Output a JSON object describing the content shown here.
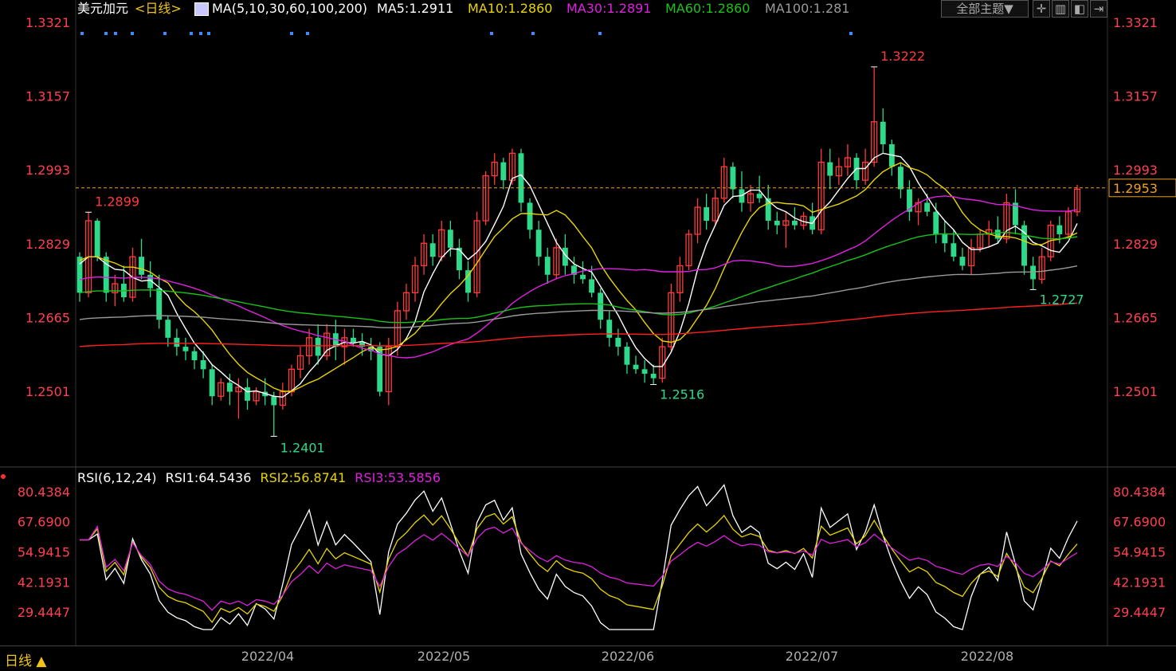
{
  "header": {
    "pair": "美元加元",
    "period": "<日线>",
    "ma_label": "MA(5,10,30,60,100,200)",
    "ma5": "MA5:1.2911",
    "ma10": "MA10:1.2860",
    "ma30": "MA30:1.2891",
    "ma60": "MA60:1.2860",
    "ma100": "MA100:1.281",
    "theme_button": "全部主题▼"
  },
  "rsi_header": {
    "label": "RSI(6,12,24)",
    "rsi1": "RSI1:64.5436",
    "rsi2": "RSI2:56.8741",
    "rsi3": "RSI3:53.5856"
  },
  "footer": {
    "period": "日线 ▲"
  },
  "colors": {
    "up": "#ff3b3b",
    "down": "#2fd98a",
    "ma5": "#ffffff",
    "ma10": "#e8d500",
    "ma30": "#e020e0",
    "ma60": "#19c219",
    "ma100": "#9a9a9a",
    "ma200": "#ff2020",
    "axis_text": "#ff4050",
    "rsi_text": "#ff4050",
    "month_text": "#b0b0b0"
  },
  "chart_data": [
    {
      "type": "candlestick",
      "title": "美元加元<日线>",
      "y_ticks": [
        1.3321,
        1.3157,
        1.2993,
        1.2829,
        1.2665,
        1.2501
      ],
      "ylim": [
        1.2501,
        1.3321
      ],
      "current_price": 1.2953,
      "annotations": [
        {
          "label": "1.2899",
          "value": 1.2899,
          "kind": "high"
        },
        {
          "label": "1.2401",
          "value": 1.2401,
          "kind": "low"
        },
        {
          "label": "1.3222",
          "value": 1.3222,
          "kind": "high"
        },
        {
          "label": "1.2516",
          "value": 1.2516,
          "kind": "low"
        },
        {
          "label": "1.2727",
          "value": 1.2727,
          "kind": "low"
        }
      ],
      "x_ticks": [
        "2022/04",
        "2022/05",
        "2022/06",
        "2022/07",
        "2022/08"
      ],
      "candles_ohlc": [
        [
          1.28,
          1.281,
          1.27,
          1.272
        ],
        [
          1.272,
          1.2899,
          1.271,
          1.288
        ],
        [
          1.288,
          1.2885,
          1.279,
          1.28
        ],
        [
          1.28,
          1.281,
          1.27,
          1.272
        ],
        [
          1.272,
          1.276,
          1.269,
          1.274
        ],
        [
          1.274,
          1.278,
          1.27,
          1.271
        ],
        [
          1.271,
          1.282,
          1.27,
          1.28
        ],
        [
          1.28,
          1.284,
          1.275,
          1.276
        ],
        [
          1.276,
          1.279,
          1.271,
          1.273
        ],
        [
          1.273,
          1.276,
          1.264,
          1.266
        ],
        [
          1.266,
          1.267,
          1.26,
          1.262
        ],
        [
          1.262,
          1.264,
          1.258,
          1.26
        ],
        [
          1.26,
          1.262,
          1.257,
          1.259
        ],
        [
          1.259,
          1.26,
          1.255,
          1.257
        ],
        [
          1.257,
          1.259,
          1.253,
          1.255
        ],
        [
          1.255,
          1.256,
          1.247,
          1.249
        ],
        [
          1.249,
          1.253,
          1.248,
          1.252
        ],
        [
          1.252,
          1.254,
          1.247,
          1.25
        ],
        [
          1.25,
          1.253,
          1.244,
          1.251
        ],
        [
          1.251,
          1.253,
          1.246,
          1.248
        ],
        [
          1.248,
          1.251,
          1.247,
          1.25
        ],
        [
          1.25,
          1.253,
          1.247,
          1.249
        ],
        [
          1.249,
          1.25,
          1.2401,
          1.247
        ],
        [
          1.247,
          1.252,
          1.246,
          1.25
        ],
        [
          1.25,
          1.256,
          1.249,
          1.255
        ],
        [
          1.255,
          1.26,
          1.253,
          1.258
        ],
        [
          1.258,
          1.264,
          1.256,
          1.262
        ],
        [
          1.262,
          1.265,
          1.256,
          1.258
        ],
        [
          1.258,
          1.265,
          1.257,
          1.263
        ],
        [
          1.263,
          1.266,
          1.257,
          1.26
        ],
        [
          1.26,
          1.264,
          1.256,
          1.262
        ],
        [
          1.262,
          1.264,
          1.26,
          1.261
        ],
        [
          1.261,
          1.263,
          1.258,
          1.26
        ],
        [
          1.26,
          1.262,
          1.257,
          1.259
        ],
        [
          1.26,
          1.261,
          1.249,
          1.25
        ],
        [
          1.25,
          1.262,
          1.247,
          1.26
        ],
        [
          1.26,
          1.27,
          1.258,
          1.268
        ],
        [
          1.268,
          1.274,
          1.266,
          1.272
        ],
        [
          1.272,
          1.28,
          1.27,
          1.278
        ],
        [
          1.278,
          1.285,
          1.276,
          1.283
        ],
        [
          1.283,
          1.285,
          1.278,
          1.28
        ],
        [
          1.28,
          1.288,
          1.279,
          1.286
        ],
        [
          1.286,
          1.288,
          1.28,
          1.282
        ],
        [
          1.282,
          1.284,
          1.275,
          1.277
        ],
        [
          1.277,
          1.279,
          1.27,
          1.272
        ],
        [
          1.272,
          1.29,
          1.271,
          1.288
        ],
        [
          1.288,
          1.299,
          1.287,
          1.298
        ],
        [
          1.298,
          1.303,
          1.296,
          1.301
        ],
        [
          1.301,
          1.302,
          1.295,
          1.297
        ],
        [
          1.297,
          1.304,
          1.296,
          1.303
        ],
        [
          1.303,
          1.304,
          1.29,
          1.292
        ],
        [
          1.292,
          1.293,
          1.284,
          1.286
        ],
        [
          1.286,
          1.288,
          1.278,
          1.28
        ],
        [
          1.28,
          1.282,
          1.274,
          1.276
        ],
        [
          1.276,
          1.284,
          1.275,
          1.282
        ],
        [
          1.282,
          1.285,
          1.276,
          1.278
        ],
        [
          1.278,
          1.28,
          1.274,
          1.276
        ],
        [
          1.276,
          1.279,
          1.274,
          1.275
        ],
        [
          1.275,
          1.278,
          1.271,
          1.272
        ],
        [
          1.272,
          1.273,
          1.264,
          1.266
        ],
        [
          1.266,
          1.268,
          1.26,
          1.262
        ],
        [
          1.262,
          1.264,
          1.258,
          1.26
        ],
        [
          1.26,
          1.261,
          1.254,
          1.256
        ],
        [
          1.256,
          1.258,
          1.254,
          1.255
        ],
        [
          1.255,
          1.257,
          1.252,
          1.254
        ],
        [
          1.254,
          1.256,
          1.2516,
          1.253
        ],
        [
          1.253,
          1.262,
          1.252,
          1.26
        ],
        [
          1.26,
          1.274,
          1.259,
          1.272
        ],
        [
          1.272,
          1.28,
          1.27,
          1.278
        ],
        [
          1.278,
          1.286,
          1.277,
          1.285
        ],
        [
          1.285,
          1.293,
          1.283,
          1.291
        ],
        [
          1.291,
          1.294,
          1.286,
          1.288
        ],
        [
          1.288,
          1.295,
          1.287,
          1.293
        ],
        [
          1.293,
          1.302,
          1.292,
          1.3
        ],
        [
          1.3,
          1.301,
          1.293,
          1.295
        ],
        [
          1.295,
          1.299,
          1.29,
          1.292
        ],
        [
          1.292,
          1.296,
          1.29,
          1.294
        ],
        [
          1.294,
          1.298,
          1.292,
          1.293
        ],
        [
          1.293,
          1.296,
          1.286,
          1.288
        ],
        [
          1.288,
          1.29,
          1.285,
          1.287
        ],
        [
          1.287,
          1.29,
          1.282,
          1.288
        ],
        [
          1.288,
          1.291,
          1.286,
          1.287
        ],
        [
          1.287,
          1.29,
          1.286,
          1.289
        ],
        [
          1.289,
          1.292,
          1.285,
          1.286
        ],
        [
          1.286,
          1.304,
          1.285,
          1.301
        ],
        [
          1.301,
          1.304,
          1.295,
          1.298
        ],
        [
          1.298,
          1.302,
          1.296,
          1.3
        ],
        [
          1.3,
          1.305,
          1.298,
          1.302
        ],
        [
          1.302,
          1.303,
          1.295,
          1.297
        ],
        [
          1.297,
          1.304,
          1.296,
          1.301
        ],
        [
          1.301,
          1.3222,
          1.3,
          1.31
        ],
        [
          1.31,
          1.313,
          1.303,
          1.305
        ],
        [
          1.305,
          1.306,
          1.298,
          1.3
        ],
        [
          1.3,
          1.301,
          1.293,
          1.295
        ],
        [
          1.295,
          1.297,
          1.288,
          1.29
        ],
        [
          1.29,
          1.293,
          1.287,
          1.292
        ],
        [
          1.292,
          1.294,
          1.289,
          1.29
        ],
        [
          1.29,
          1.292,
          1.283,
          1.285
        ],
        [
          1.285,
          1.288,
          1.281,
          1.283
        ],
        [
          1.283,
          1.286,
          1.279,
          1.28
        ],
        [
          1.28,
          1.282,
          1.277,
          1.278
        ],
        [
          1.278,
          1.284,
          1.276,
          1.282
        ],
        [
          1.282,
          1.286,
          1.281,
          1.285
        ],
        [
          1.285,
          1.288,
          1.282,
          1.286
        ],
        [
          1.286,
          1.289,
          1.283,
          1.284
        ],
        [
          1.284,
          1.294,
          1.283,
          1.292
        ],
        [
          1.292,
          1.295,
          1.285,
          1.287
        ],
        [
          1.287,
          1.288,
          1.276,
          1.278
        ],
        [
          1.278,
          1.28,
          1.2727,
          1.275
        ],
        [
          1.275,
          1.282,
          1.274,
          1.28
        ],
        [
          1.28,
          1.288,
          1.279,
          1.287
        ],
        [
          1.287,
          1.289,
          1.283,
          1.285
        ],
        [
          1.285,
          1.291,
          1.284,
          1.29
        ],
        [
          1.29,
          1.296,
          1.289,
          1.295
        ]
      ],
      "ma_series": [
        "MA5",
        "MA10",
        "MA30",
        "MA60",
        "MA100",
        "MA200"
      ]
    },
    {
      "type": "line",
      "title": "RSI(6,12,24)",
      "y_ticks": [
        80.4384,
        67.69,
        54.9415,
        42.1931,
        29.4447
      ],
      "y_tick_labels": [
        "80.4384",
        "67.6900",
        "54.9415",
        "42.1931",
        "29.4447"
      ],
      "ylim": [
        23,
        83
      ],
      "series": [
        {
          "name": "RSI1",
          "last": 64.5436
        },
        {
          "name": "RSI2",
          "last": 56.8741
        },
        {
          "name": "RSI3",
          "last": 53.5856
        }
      ]
    }
  ]
}
